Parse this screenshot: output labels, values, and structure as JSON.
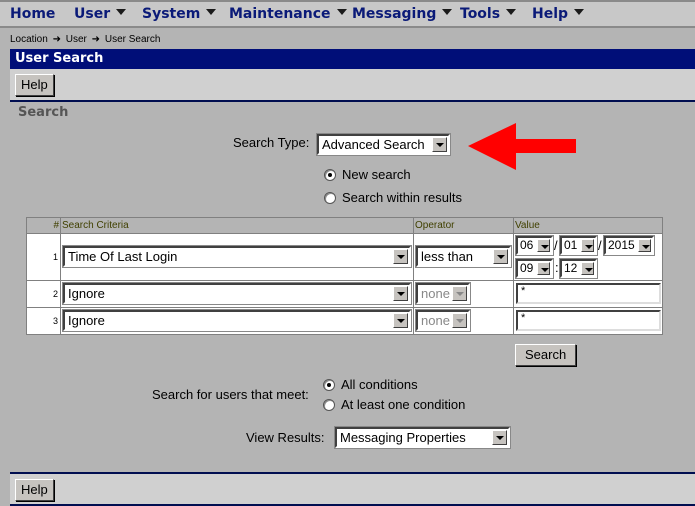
{
  "menu": {
    "items": [
      {
        "label": "Home",
        "has_dropdown": false
      },
      {
        "label": "User",
        "has_dropdown": true
      },
      {
        "label": "System",
        "has_dropdown": true
      },
      {
        "label": "Maintenance",
        "has_dropdown": true
      },
      {
        "label": "Messaging",
        "has_dropdown": true
      },
      {
        "label": "Tools",
        "has_dropdown": true
      },
      {
        "label": "Help",
        "has_dropdown": true
      }
    ]
  },
  "breadcrumb": {
    "items": [
      "Location",
      "User",
      "User Search"
    ],
    "separator_icon": "arrow-right-icon",
    "separator_glyph": "➜"
  },
  "page_title": "User Search",
  "toolbar": {
    "help_label": "Help"
  },
  "section_label": "Search",
  "search_type": {
    "label": "Search Type:",
    "selected": "Advanced Search"
  },
  "search_mode": {
    "options": [
      {
        "label": "New search",
        "checked": true
      },
      {
        "label": "Search within results",
        "checked": false
      }
    ]
  },
  "criteria_table": {
    "headers": {
      "num": "#",
      "criteria": "Search Criteria",
      "operator": "Operator",
      "value": "Value"
    },
    "rows": [
      {
        "num": "1",
        "criteria": "Time Of Last Login",
        "operator": "less than",
        "operator_disabled": false,
        "date": {
          "month": "06",
          "day": "01",
          "year": "2015",
          "hour": "09",
          "minute": "12",
          "date_sep": "/",
          "time_sep": ":"
        }
      },
      {
        "num": "2",
        "criteria": "Ignore",
        "operator": "none",
        "operator_disabled": true,
        "value": "*"
      },
      {
        "num": "3",
        "criteria": "Ignore",
        "operator": "none",
        "operator_disabled": true,
        "value": "*"
      }
    ]
  },
  "search_button": "Search",
  "match": {
    "label": "Search for users that meet:",
    "options": [
      {
        "label": "All conditions",
        "checked": true
      },
      {
        "label": "At least one condition",
        "checked": false
      }
    ]
  },
  "view_results": {
    "label": "View Results:",
    "selected": "Messaging Properties"
  },
  "annotation": {
    "color": "#ff0000",
    "direction": "left"
  },
  "colors": {
    "menu_text": "#0a1a78",
    "title_bar": "#000e78",
    "background": "#b4b4b4",
    "toolbar": "#d0d0d0"
  }
}
